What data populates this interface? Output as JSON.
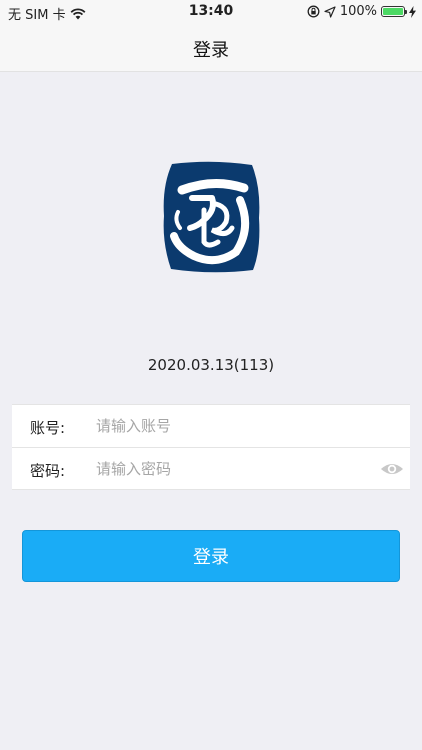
{
  "status_bar": {
    "carrier": "无 SIM 卡",
    "time": "13:40",
    "battery": "100%",
    "battery_level": 1.0
  },
  "nav": {
    "title": "登录"
  },
  "version": "2020.03.13(113)",
  "form": {
    "account": {
      "label": "账号:",
      "placeholder": "请输入账号",
      "value": ""
    },
    "password": {
      "label": "密码:",
      "placeholder": "请输入密码",
      "value": ""
    }
  },
  "login_button": {
    "label": "登录"
  },
  "colors": {
    "accent": "#1aacf6",
    "logo_blue": "#0b3a6e",
    "background": "#efeff4"
  },
  "icons": {
    "wifi": "wifi-icon",
    "orientation_lock": "orientation-lock-icon",
    "location": "location-arrow-icon",
    "charging": "bolt-icon",
    "password_visibility": "eye-icon",
    "logo": "seal-logo"
  }
}
